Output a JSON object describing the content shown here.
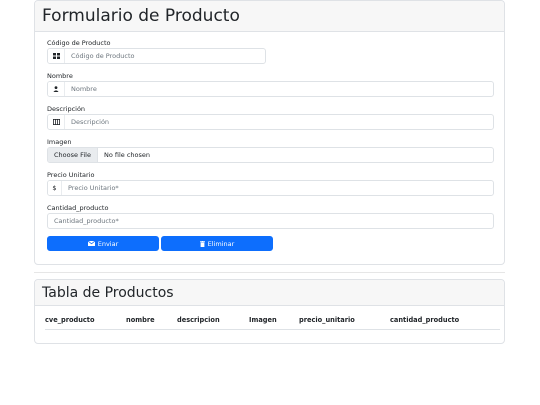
{
  "form": {
    "title": "Formulario de Producto",
    "codigo": {
      "label": "Código de Producto",
      "placeholder": "Código de Producto",
      "icon": "card-icon"
    },
    "nombre": {
      "label": "Nombre",
      "placeholder": "Nombre",
      "icon": "person-icon"
    },
    "descripcion": {
      "label": "Descripción",
      "placeholder": "Descripción",
      "icon": "columns-icon"
    },
    "imagen": {
      "label": "Imagen",
      "button": "Choose File",
      "status": "No file chosen"
    },
    "precio": {
      "label": "Precio Unitario",
      "prefix": "$",
      "placeholder": "Precio Unitario*"
    },
    "cantidad": {
      "label": "Cantidad_producto",
      "placeholder": "Cantidad_producto*"
    },
    "submit_label": "Enviar",
    "delete_label": "Eliminar"
  },
  "table": {
    "title": "Tabla de Productos",
    "columns": [
      "cve_producto",
      "nombre",
      "descripcion",
      "Imagen",
      "precio_unitario",
      "cantidad_producto"
    ]
  },
  "colors": {
    "primary": "#0d6efd",
    "header_bg": "#f7f7f7",
    "border": "#dee2e6"
  }
}
